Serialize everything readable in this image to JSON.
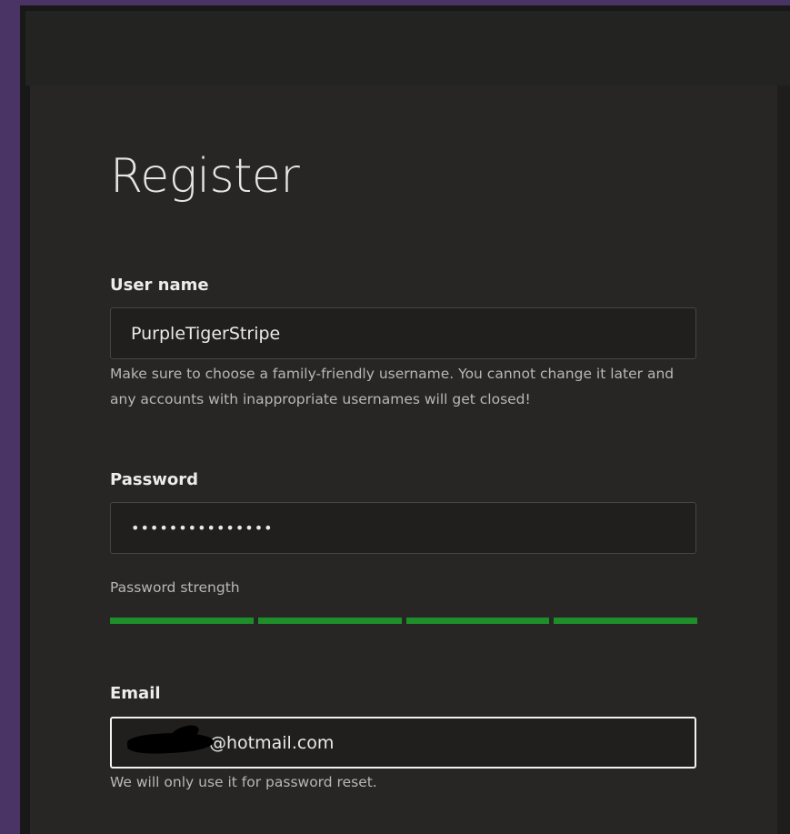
{
  "form": {
    "title": "Register",
    "username": {
      "label": "User name",
      "value": "PurpleTigerStripe",
      "help": "Make sure to choose a family-friendly username. You cannot change it later and any accounts with inappropriate usernames will get closed!"
    },
    "password": {
      "label": "Password",
      "value": "•••••••••••••••",
      "strength_label": "Password strength",
      "strength_segments_filled": 4,
      "strength_segments_total": 4,
      "strength_color": "#1e8e2a"
    },
    "email": {
      "label": "Email",
      "value": "@hotmail.com",
      "help": "We will only use it for password reset."
    }
  },
  "colors": {
    "background": "#4a3466",
    "panel": "#272624",
    "accent_strength": "#1e8e2a"
  }
}
